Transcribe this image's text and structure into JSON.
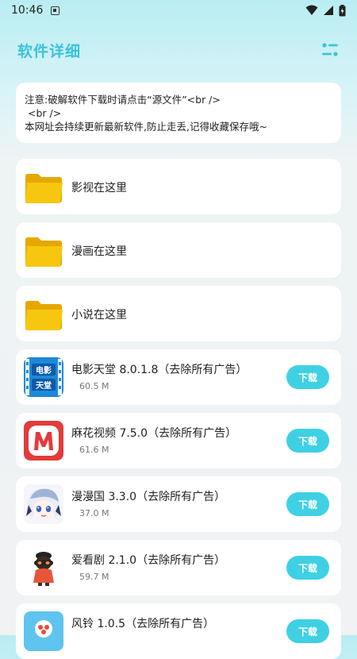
{
  "status_bar": {
    "time": "10:46"
  },
  "header": {
    "title": "软件详细"
  },
  "notice": {
    "lines": [
      "注意:破解软件下载时请点击“源文件”<br />",
      " <br />",
      "本网址会持续更新最新软件,防止走丢,记得收藏保存哦~"
    ]
  },
  "folders": [
    {
      "label": "影视在这里",
      "icon": "folder-icon"
    },
    {
      "label": "漫画在这里",
      "icon": "folder-icon"
    },
    {
      "label": "小说在这里",
      "icon": "folder-icon"
    }
  ],
  "apps": [
    {
      "name": "电影天堂 8.0.1.8（去除所有广告）",
      "size": "60.5 M",
      "download_label": "下载",
      "icon": "movie-heaven-icon",
      "icon_text_top": "电影",
      "icon_text_bottom": "天堂"
    },
    {
      "name": "麻花视频 7.5.0（去除所有广告）",
      "size": "61.6 M",
      "download_label": "下载",
      "icon": "mahua-video-icon"
    },
    {
      "name": "漫漫国 3.3.0（去除所有广告）",
      "size": "37.0 M",
      "download_label": "下载",
      "icon": "anime-girl-icon"
    },
    {
      "name": "爱看剧 2.1.0（去除所有广告）",
      "size": "59.7 M",
      "download_label": "下载",
      "icon": "character-icon"
    },
    {
      "name": "风铃 1.0.5（去除所有广告）",
      "size": "",
      "download_label": "下载",
      "icon": "fengling-icon"
    }
  ],
  "colors": {
    "accent": "#3cc3db",
    "button": "#3fd0e3",
    "folder": "#f7c70f"
  }
}
